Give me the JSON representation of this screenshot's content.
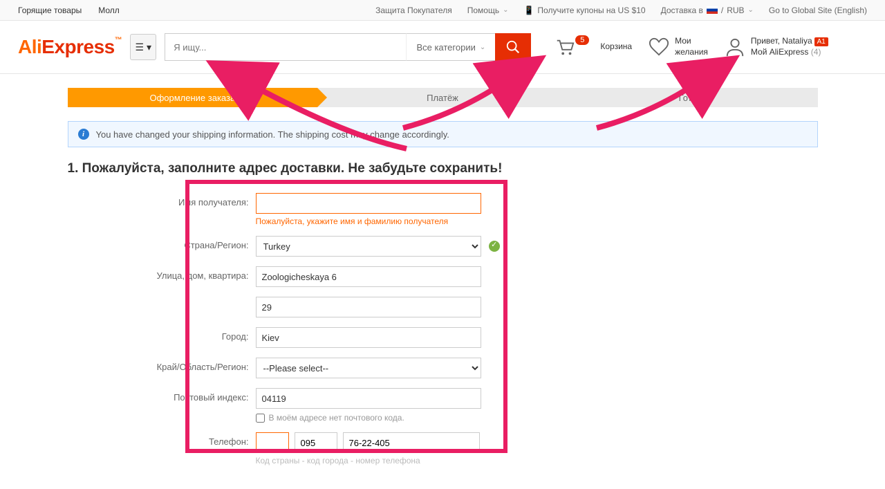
{
  "topbar": {
    "hot": "Горящие товары",
    "mall": "Молл",
    "protection": "Защита Покупателя",
    "help": "Помощь",
    "coupons": "Получите купоны на US $10",
    "shipto": "Доставка в",
    "currency": "RUB",
    "global": "Go to Global Site (English)"
  },
  "header": {
    "search_placeholder": "Я ищу...",
    "search_cat": "Все категории",
    "cart_label": "Корзина",
    "cart_count": "5",
    "wish_label1": "Мои",
    "wish_label2": "желания",
    "greet": "Привет, Nataliya",
    "account": "Мой AliExpress",
    "acc_count": "(4)"
  },
  "steps": {
    "s1": "Оформление заказа",
    "s2": "Платёж",
    "s3": "Готово"
  },
  "info": "You have changed your shipping information. The shipping cost may change accordingly.",
  "title": "1. Пожалуйста, заполните адрес доставки. Не забудьте сохранить!",
  "labels": {
    "name": "Имя получателя:",
    "country": "Страна/Регион:",
    "street": "Улица, дом, квартира:",
    "city": "Город:",
    "region": "Край/Область/Регион:",
    "zip": "Почтовый индекс:",
    "phone": "Телефон:"
  },
  "values": {
    "name": "",
    "name_error": "Пожалуйста, укажите имя и фамилию получателя",
    "country": "Turkey",
    "street1": "Zoologicheskaya 6",
    "street2": "29",
    "city": "Kiev",
    "region": "--Please select--",
    "zip": "04119",
    "no_postal": "В моём адресе нет почтового кода.",
    "phone_cc": "",
    "phone_area": "095",
    "phone_num": "76-22-405",
    "phone_hint": "Код страны - код города - номер телефона"
  }
}
